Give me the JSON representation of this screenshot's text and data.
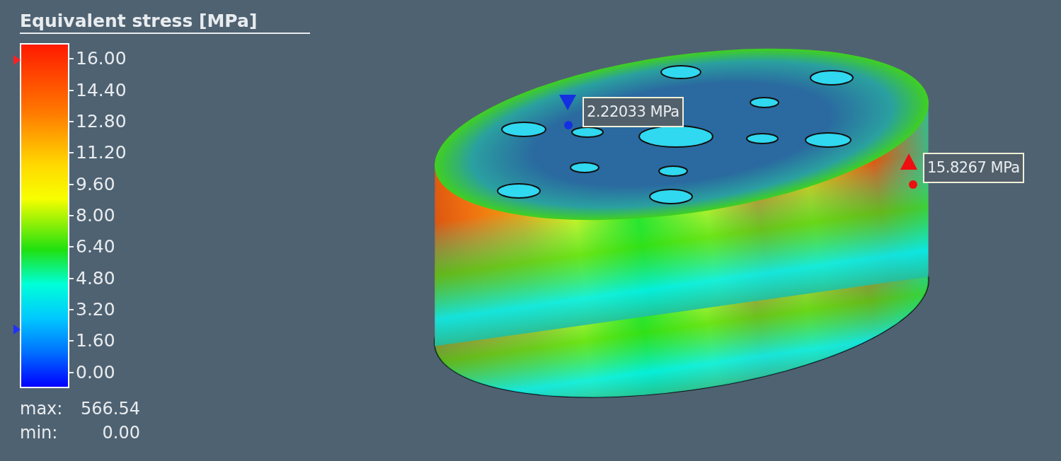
{
  "legend": {
    "title": "Equivalent stress [MPa]",
    "ticks": [
      "16.00",
      "14.40",
      "12.80",
      "11.20",
      "9.60",
      "8.00",
      "6.40",
      "4.80",
      "3.20",
      "1.60",
      "0.00"
    ],
    "max": {
      "label": "max:",
      "value": "566.54"
    },
    "min": {
      "label": "min:",
      "value": "0.00"
    }
  },
  "probes": [
    {
      "kind": "min",
      "label": "2.22033 MPa"
    },
    {
      "kind": "max",
      "label": "15.8267 MPa"
    }
  ]
}
